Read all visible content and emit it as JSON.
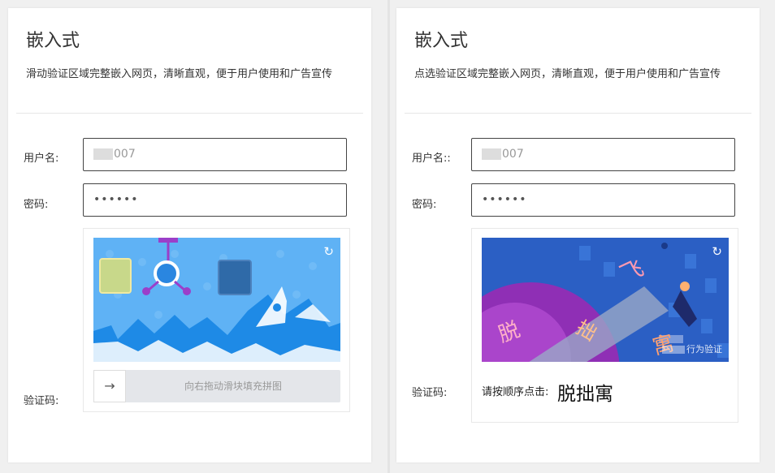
{
  "left_panel": {
    "title": "嵌入式",
    "description": "滑动验证区域完整嵌入网页，清晰直观，便于用户使用和广告宣传",
    "username_label": "用户名:",
    "username_value": "007",
    "password_label": "密码:",
    "password_value": "••••••",
    "captcha_label": "验证码:",
    "slider_text": "向右拖动滑块填充拼图",
    "slider_arrow": "→",
    "refresh_icon": "↻"
  },
  "right_panel": {
    "title": "嵌入式",
    "description": "点选验证区域完整嵌入网页，清晰直观，便于用户使用和广告宣传",
    "username_label": "用户名::",
    "username_value": "007",
    "password_label": "密码:",
    "password_value": "••••••",
    "captcha_label": "验证码:",
    "prompt": "请按顺序点击:",
    "target_chars": "脱拙寓",
    "watermark": "行为验证",
    "img_chars": [
      "脱",
      "拙",
      "寓",
      "飞"
    ],
    "refresh_icon": "↻"
  }
}
